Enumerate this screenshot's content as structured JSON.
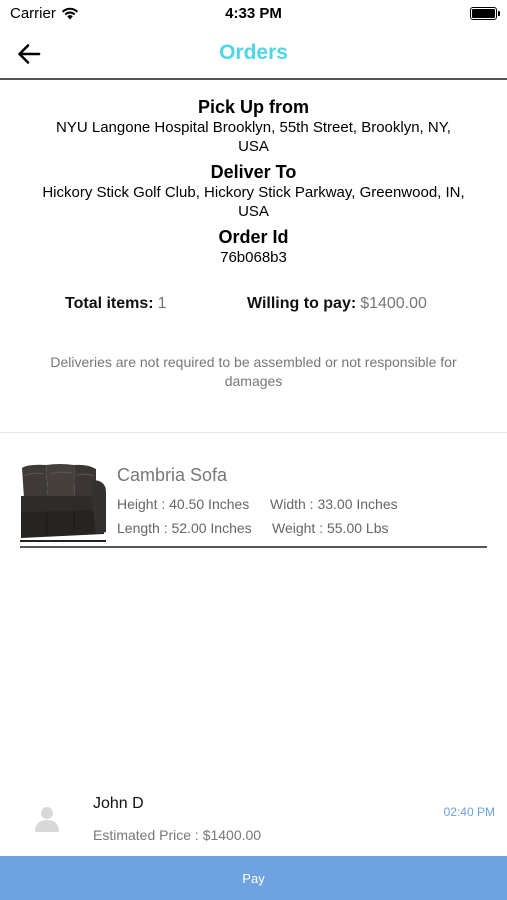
{
  "status_bar": {
    "carrier": "Carrier",
    "time": "4:33 PM",
    "icons": [
      "wifi-icon",
      "battery-icon"
    ]
  },
  "nav": {
    "title": "Orders",
    "back_icon": "arrow-left-icon",
    "title_color": "#4fd6e3"
  },
  "order": {
    "pickup_title": "Pick Up from",
    "pickup_address": "NYU Langone Hospital Brooklyn, 55th Street, Brooklyn, NY, USA",
    "deliver_title": "Deliver To",
    "deliver_address": "Hickory Stick Golf Club, Hickory Stick Parkway, Greenwood, IN, USA",
    "order_id_title": "Order Id",
    "order_id": "76b068b3",
    "total_items_label": "Total items:",
    "total_items_value": "1",
    "willing_to_pay_label": "Willing to pay:",
    "willing_to_pay_value": "$1400.00",
    "disclaimer": "Deliveries are not required to be assembled or not responsible for damages"
  },
  "items": [
    {
      "name": "Cambria Sofa",
      "image": "sofa-image",
      "height": "Height : 40.50 Inches",
      "width": "Width : 33.00 Inches",
      "length": "Length : 52.00 Inches",
      "weight": "Weight : 55.00 Lbs"
    }
  ],
  "bid": {
    "avatar_icon": "user-avatar-icon",
    "name": "John D",
    "time": "02:40 PM",
    "estimated_price": "Estimated Price : $1400.00"
  },
  "footer": {
    "pay_label": "Pay",
    "pay_color": "#6ea2e0"
  }
}
